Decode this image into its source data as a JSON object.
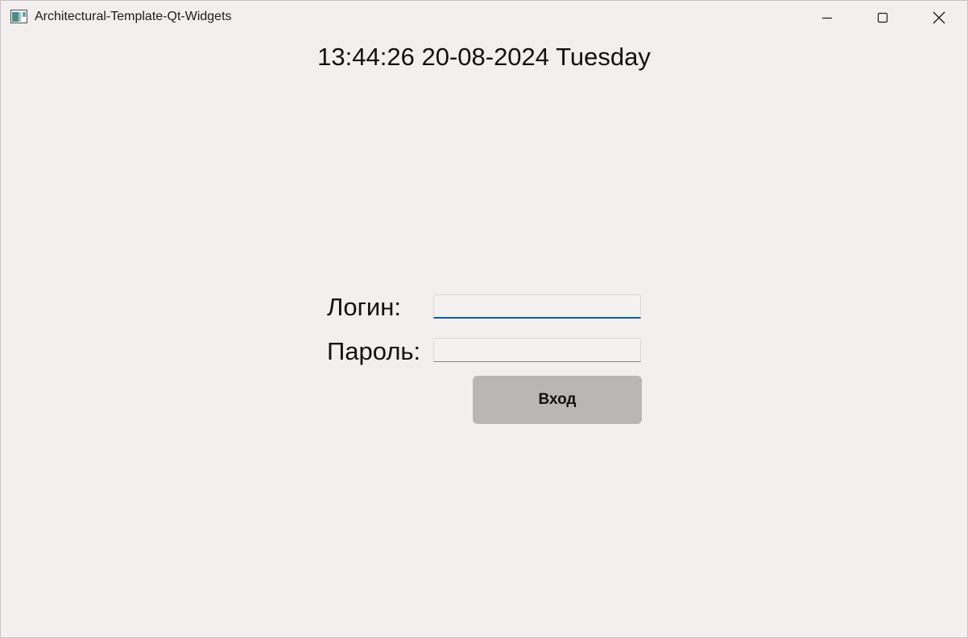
{
  "window": {
    "title": "Architectural-Template-Qt-Widgets",
    "icon": "app-window-icon",
    "controls": {
      "minimize_icon": "minimize-icon",
      "maximize_icon": "maximize-icon",
      "close_icon": "close-icon"
    }
  },
  "main": {
    "clock_text": "13:44:26 20-08-2024 Tuesday",
    "login_label": "Логин:",
    "login_value": "",
    "password_label": "Пароль:",
    "password_value": "",
    "submit_label": "Вход"
  },
  "colors": {
    "background": "#f3efee",
    "focus_accent": "#0a5bb5",
    "button_bg": "#bab6b5"
  }
}
